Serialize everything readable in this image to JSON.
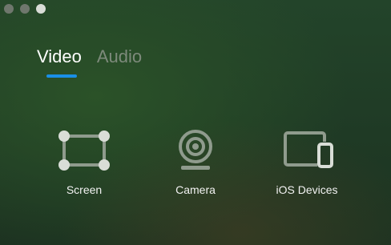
{
  "window": {
    "controls": [
      "close",
      "minimize",
      "zoom"
    ]
  },
  "tabs": [
    {
      "label": "Video",
      "active": true
    },
    {
      "label": "Audio",
      "active": false
    }
  ],
  "colors": {
    "accent": "#1a8fe6",
    "icon": "#8f9b8d",
    "inactive_tab": "#7d8a7b"
  },
  "sources": [
    {
      "label": "Screen",
      "icon": "screen-selection-icon"
    },
    {
      "label": "Camera",
      "icon": "webcam-icon"
    },
    {
      "label": "iOS Devices",
      "icon": "ios-devices-icon"
    }
  ]
}
